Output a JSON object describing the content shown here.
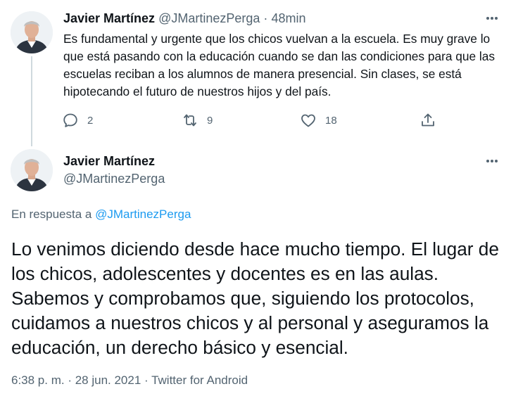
{
  "parent_tweet": {
    "author_name": "Javier Martínez",
    "handle": "@JMartinezPerga",
    "separator": "·",
    "time_ago": "48min",
    "text": "Es fundamental y urgente que los chicos vuelvan a la escuela. Es muy grave lo que está pasando con la educación cuando se dan las condiciones para que las escuelas reciban a los alumnos de manera presencial. Sin clases, se está hipotecando el futuro de nuestros hijos y del país.",
    "actions": {
      "reply_count": "2",
      "retweet_count": "9",
      "like_count": "18"
    }
  },
  "main_tweet": {
    "author_name": "Javier Martínez",
    "handle": "@JMartinezPerga",
    "reply_prefix": "En respuesta a",
    "reply_to": "@JMartinezPerga",
    "text": "Lo venimos diciendo desde hace mucho tiempo. El lugar de los chicos, adolescentes y docentes es en las aulas. Sabemos y comprobamos que, siguiendo los protocolos, cuidamos a nuestros chicos y al personal y aseguramos la educación, un derecho básico y esencial.",
    "meta": "6:38 p. m. · 28 jun. 2021 · Twitter for Android"
  },
  "colors": {
    "text": "#0f1419",
    "secondary": "#536471",
    "link": "#1d9bf0",
    "thread_line": "#cfd9de"
  },
  "icons": [
    "more-icon",
    "reply-icon",
    "retweet-icon",
    "like-icon",
    "share-icon"
  ]
}
